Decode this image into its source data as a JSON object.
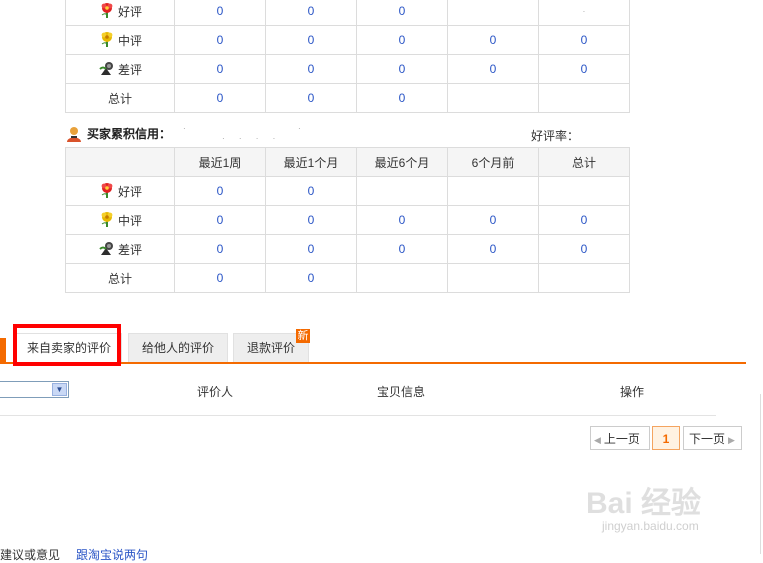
{
  "seller_table": {
    "rows": [
      {
        "label": "好评",
        "icon": "red-flower-icon",
        "values": [
          "0",
          "0",
          "0",
          "",
          ""
        ]
      },
      {
        "label": "中评",
        "icon": "yellow-flower-icon",
        "values": [
          "0",
          "0",
          "0",
          "0",
          "0"
        ]
      },
      {
        "label": "差评",
        "icon": "broken-flower-icon",
        "values": [
          "0",
          "0",
          "0",
          "0",
          "0"
        ]
      },
      {
        "label": "总计",
        "icon": "",
        "values": [
          "0",
          "0",
          "0",
          "",
          ""
        ]
      }
    ],
    "stray_dot": "·"
  },
  "buyer": {
    "title": "买家累积信用：",
    "rate_label": "好评率：",
    "header": [
      "",
      "最近1周",
      "最近1个月",
      "最近6个月",
      "6个月前",
      "总计"
    ],
    "rows": [
      {
        "label": "好评",
        "icon": "red-flower-icon",
        "values": [
          "0",
          "0",
          "",
          "",
          ""
        ]
      },
      {
        "label": "中评",
        "icon": "yellow-flower-icon",
        "values": [
          "0",
          "0",
          "0",
          "0",
          "0"
        ]
      },
      {
        "label": "差评",
        "icon": "broken-flower-icon",
        "values": [
          "0",
          "0",
          "0",
          "0",
          "0"
        ]
      },
      {
        "label": "总计",
        "icon": "",
        "values": [
          "0",
          "0",
          "",
          "",
          ""
        ]
      }
    ]
  },
  "tabs": {
    "seller": "来自卖家的评价",
    "others": "给他人的评价",
    "refund": "退款评价",
    "new_badge": "新"
  },
  "list": {
    "col_rater": "评价人",
    "col_item": "宝贝信息",
    "col_action": "操作"
  },
  "pagination": {
    "prev": "上一页",
    "current": "1",
    "next": "下一页"
  },
  "watermark": {
    "logo": "Bai 经验",
    "url": "jingyan.baidu.com"
  },
  "footer": {
    "text": "建议或意见",
    "link": "跟淘宝说两句"
  },
  "colors": {
    "accent": "#f46a00",
    "link": "#2a55c6",
    "highlight": "#ff0000"
  }
}
